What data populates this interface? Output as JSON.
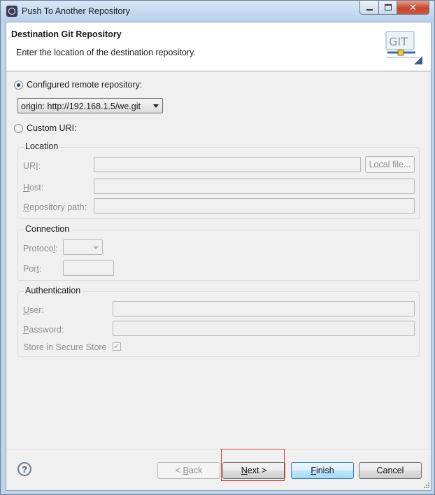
{
  "window": {
    "title": "Push To Another Repository"
  },
  "header": {
    "title": "Destination Git Repository",
    "description": "Enter the location of the destination repository.",
    "logo_text": "GIT"
  },
  "configured_remote": {
    "label": "Configured remote repository:",
    "selected": true,
    "combo_value": "origin: http://192.168.1.5/we.git"
  },
  "custom_uri": {
    "label": "Custom URI:",
    "selected": false
  },
  "location": {
    "title": "Location",
    "uri_label": "URI:",
    "uri_label_prefix": "UR",
    "uri_label_mnemonic": "I",
    "uri_label_suffix": ":",
    "uri_value": "",
    "local_file_label": "Local file...",
    "host_label_mnemonic": "H",
    "host_label_rest": "ost:",
    "host_value": "",
    "repo_path_label_mnemonic": "R",
    "repo_path_label_rest": "epository path:",
    "repo_path_value": ""
  },
  "connection": {
    "title": "Connection",
    "protocol_label_prefix": "Protoco",
    "protocol_label_mnemonic": "l",
    "protocol_label_suffix": ":",
    "protocol_value": "",
    "port_label_prefix": "Por",
    "port_label_mnemonic": "t",
    "port_label_suffix": ":",
    "port_value": ""
  },
  "authentication": {
    "title": "Authentication",
    "user_label_mnemonic": "U",
    "user_label_rest": "ser:",
    "user_value": "",
    "password_label_mnemonic": "P",
    "password_label_rest": "assword:",
    "password_value": "",
    "store_label": "Store in Secure Store",
    "store_checked": true,
    "check_glyph": "✓"
  },
  "footer": {
    "help_glyph": "?",
    "back_prefix": "< ",
    "back_mnemonic": "B",
    "back_rest": "ack",
    "next_mnemonic": "N",
    "next_rest": "ext >",
    "finish_mnemonic": "F",
    "finish_rest": "inish",
    "cancel_label": "Cancel"
  },
  "colors": {
    "title_bar": "#c7dbf1",
    "close_button": "#c6452d",
    "finish_highlight": "#3c7fb1",
    "focus_outline": "#d9342b"
  }
}
